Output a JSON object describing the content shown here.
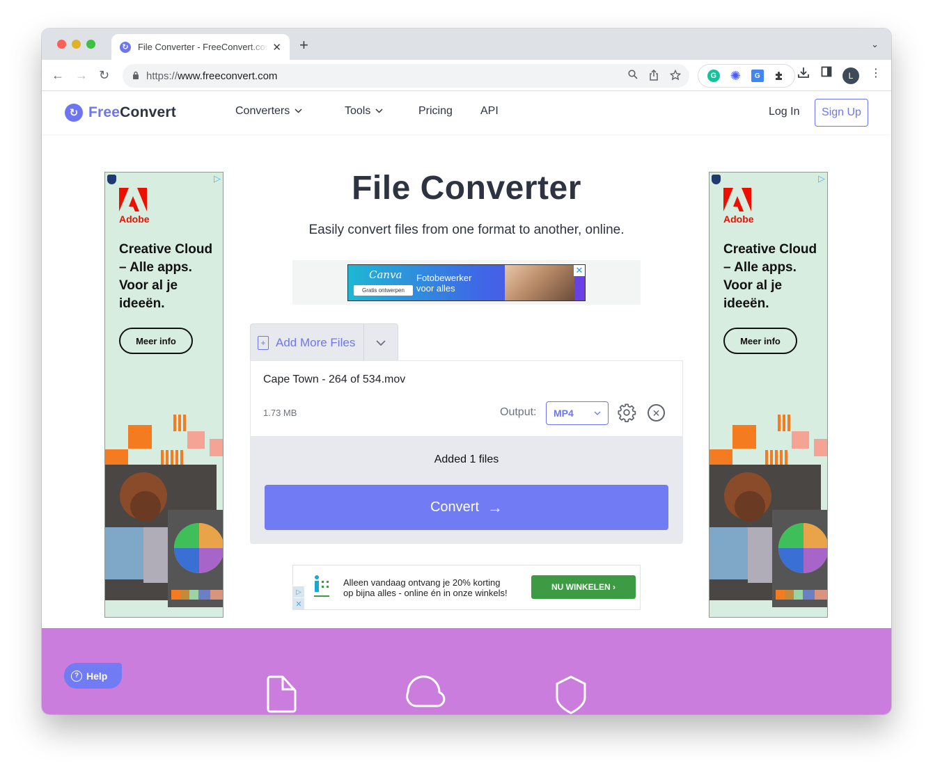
{
  "browser": {
    "tab_title": "File Converter - FreeConvert.com",
    "tab_close": "✕",
    "new_tab": "+",
    "tab_dropdown": "⌄",
    "url_scheme": "https://",
    "url_host": "www.freeconvert.com",
    "avatar_letter": "L",
    "icons": {
      "back": "←",
      "forward": "→",
      "reload": "↻",
      "lock": "🔒",
      "zoom": "⚲",
      "share": "⇪",
      "bookmark": "☆",
      "grammarly": "G",
      "asterisk": "✺",
      "translate": "G",
      "puzzle": "✚",
      "download": "⤓",
      "sidepanel": "◧",
      "menu": "⋮"
    }
  },
  "site": {
    "logo_free": "Free",
    "logo_convert": "Convert",
    "logo_mark": "↻",
    "nav": {
      "converters": "Converters",
      "tools": "Tools",
      "pricing": "Pricing",
      "api": "API",
      "chevron": "⌄"
    },
    "login": "Log In",
    "signup": "Sign Up"
  },
  "side_ads": {
    "brand": "Adobe",
    "headline": "Creative Cloud – Alle apps. Voor al je ideeën.",
    "cta": "Meer info",
    "adchoice": "▷"
  },
  "hero": {
    "title": "File Converter",
    "subtitle": "Easily convert files from one format to another, online."
  },
  "top_ad": {
    "brand": "Canva",
    "button": "Gratis ontwerpen",
    "text_line1": "Fotobewerker",
    "text_line2": "voor alles",
    "close": "✕"
  },
  "uploader": {
    "add_files": "Add More Files",
    "add_icon": "+",
    "dropdown_chevron": "⌄",
    "file": {
      "name": "Cape Town - 264 of 534.mov",
      "size": "1.73 MB",
      "output_label": "Output:",
      "output_format": "MP4",
      "remove": "✕"
    },
    "status": "Added 1 files",
    "convert_label": "Convert",
    "convert_arrow": "→"
  },
  "bottom_ad": {
    "text_line1": "Alleen vandaag ontvang je 20% korting",
    "text_line2": "op bijna alles - online én in onze winkels!",
    "cta": "NU WINKELEN  ›",
    "adchoice": "▷",
    "close": "✕"
  },
  "help": {
    "label": "Help",
    "icon": "?"
  },
  "colors": {
    "brand": "#6d76f0",
    "convert_button": "#717cf4",
    "features_band": "#cb7ddd",
    "shop_button": "#3d9b44"
  }
}
